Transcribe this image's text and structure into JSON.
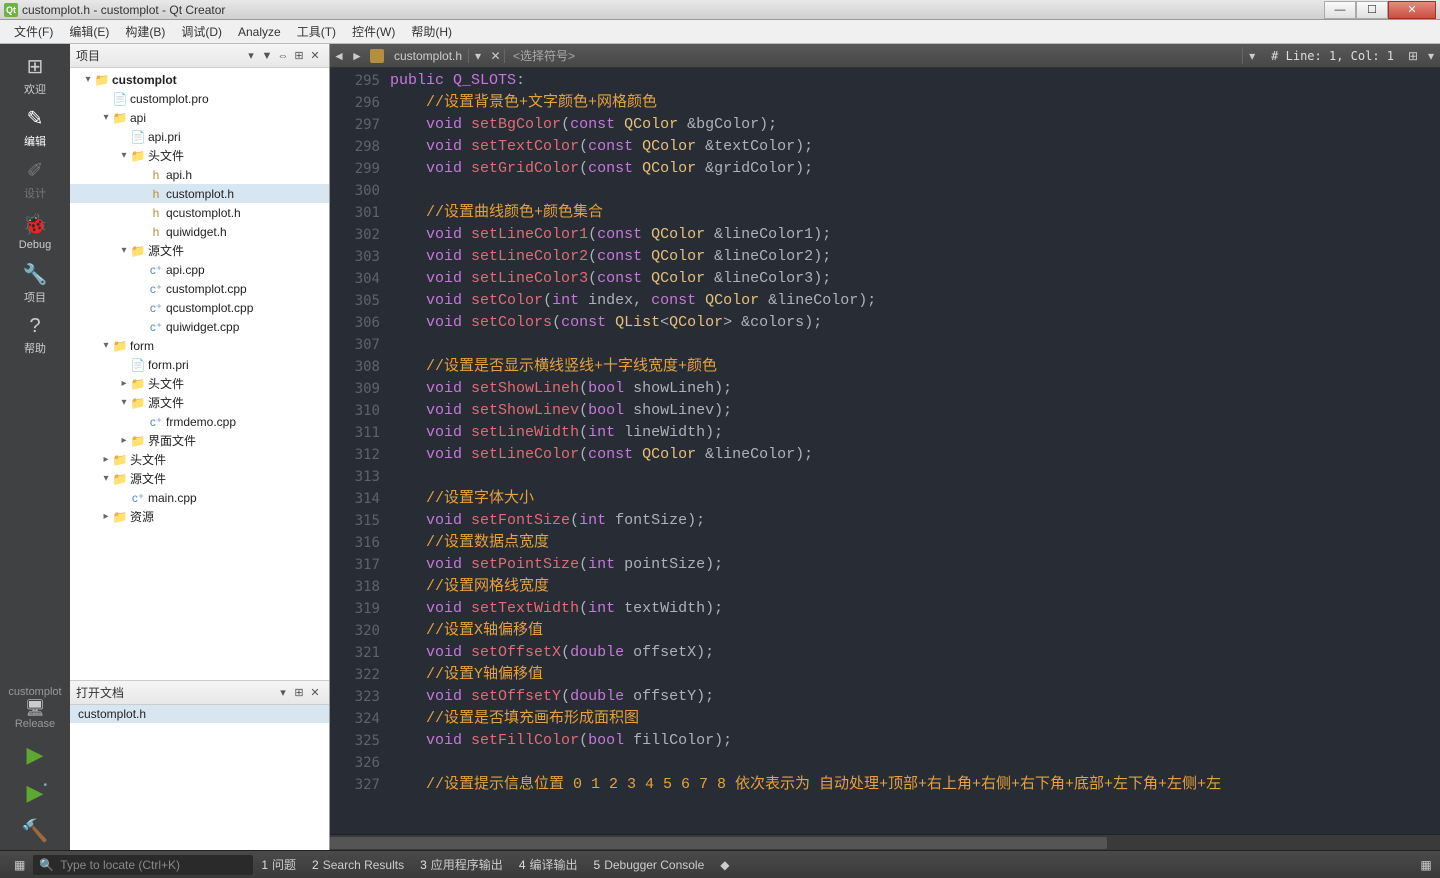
{
  "window": {
    "title": "customplot.h - customplot - Qt Creator"
  },
  "menus": [
    "文件(F)",
    "编辑(E)",
    "构建(B)",
    "调试(D)",
    "Analyze",
    "工具(T)",
    "控件(W)",
    "帮助(H)"
  ],
  "modes": [
    {
      "icon": "⊞",
      "label": "欢迎"
    },
    {
      "icon": "✎",
      "label": "编辑",
      "active": true
    },
    {
      "icon": "✐",
      "label": "设计",
      "dim": true
    },
    {
      "icon": "🐞",
      "label": "Debug"
    },
    {
      "icon": "🔧",
      "label": "项目"
    },
    {
      "icon": "?",
      "label": "帮助"
    }
  ],
  "kit": {
    "project": "customplot",
    "config": "Release"
  },
  "projectPanel": {
    "title": "项目"
  },
  "tree": [
    {
      "d": 0,
      "tw": "▾",
      "icon": "folder",
      "name": "customplot",
      "bold": true
    },
    {
      "d": 1,
      "tw": "",
      "icon": "pro",
      "name": "customplot.pro"
    },
    {
      "d": 1,
      "tw": "▾",
      "icon": "folder",
      "name": "api"
    },
    {
      "d": 2,
      "tw": "",
      "icon": "pri",
      "name": "api.pri"
    },
    {
      "d": 2,
      "tw": "▾",
      "icon": "folder",
      "name": "头文件"
    },
    {
      "d": 3,
      "tw": "",
      "icon": "h",
      "name": "api.h"
    },
    {
      "d": 3,
      "tw": "",
      "icon": "h",
      "name": "customplot.h",
      "sel": true
    },
    {
      "d": 3,
      "tw": "",
      "icon": "h",
      "name": "qcustomplot.h"
    },
    {
      "d": 3,
      "tw": "",
      "icon": "h",
      "name": "quiwidget.h"
    },
    {
      "d": 2,
      "tw": "▾",
      "icon": "folder",
      "name": "源文件"
    },
    {
      "d": 3,
      "tw": "",
      "icon": "cpp",
      "name": "api.cpp"
    },
    {
      "d": 3,
      "tw": "",
      "icon": "cpp",
      "name": "customplot.cpp"
    },
    {
      "d": 3,
      "tw": "",
      "icon": "cpp",
      "name": "qcustomplot.cpp"
    },
    {
      "d": 3,
      "tw": "",
      "icon": "cpp",
      "name": "quiwidget.cpp"
    },
    {
      "d": 1,
      "tw": "▾",
      "icon": "folder",
      "name": "form"
    },
    {
      "d": 2,
      "tw": "",
      "icon": "pri",
      "name": "form.pri"
    },
    {
      "d": 2,
      "tw": "▸",
      "icon": "folder",
      "name": "头文件"
    },
    {
      "d": 2,
      "tw": "▾",
      "icon": "folder",
      "name": "源文件"
    },
    {
      "d": 3,
      "tw": "",
      "icon": "cpp",
      "name": "frmdemo.cpp"
    },
    {
      "d": 2,
      "tw": "▸",
      "icon": "folder",
      "name": "界面文件"
    },
    {
      "d": 1,
      "tw": "▸",
      "icon": "folder",
      "name": "头文件"
    },
    {
      "d": 1,
      "tw": "▾",
      "icon": "folder",
      "name": "源文件"
    },
    {
      "d": 2,
      "tw": "",
      "icon": "cpp",
      "name": "main.cpp"
    },
    {
      "d": 1,
      "tw": "▸",
      "icon": "folder",
      "name": "资源"
    }
  ],
  "openDocs": {
    "title": "打开文档",
    "items": [
      "customplot.h"
    ]
  },
  "editorBar": {
    "file": "customplot.h",
    "symbol": "<选择符号>",
    "lineinfo": "# Line: 1, Col: 1"
  },
  "code": {
    "startLine": 295,
    "lines": [
      [
        [
          "kw",
          "public"
        ],
        [
          "plain",
          " "
        ],
        [
          "macro",
          "Q_SLOTS"
        ],
        [
          "punct",
          ":"
        ]
      ],
      [
        [
          "plain",
          "    "
        ],
        [
          "comment",
          "//设置背景色+文字颜色+网格颜色"
        ]
      ],
      [
        [
          "plain",
          "    "
        ],
        [
          "kw",
          "void"
        ],
        [
          "plain",
          " "
        ],
        [
          "fn",
          "setBgColor"
        ],
        [
          "punct",
          "("
        ],
        [
          "kw",
          "const"
        ],
        [
          "plain",
          " "
        ],
        [
          "cls",
          "QColor"
        ],
        [
          "plain",
          " "
        ],
        [
          "param",
          "&bgColor"
        ],
        [
          "punct",
          ");"
        ]
      ],
      [
        [
          "plain",
          "    "
        ],
        [
          "kw",
          "void"
        ],
        [
          "plain",
          " "
        ],
        [
          "fn",
          "setTextColor"
        ],
        [
          "punct",
          "("
        ],
        [
          "kw",
          "const"
        ],
        [
          "plain",
          " "
        ],
        [
          "cls",
          "QColor"
        ],
        [
          "plain",
          " "
        ],
        [
          "param",
          "&textColor"
        ],
        [
          "punct",
          ");"
        ]
      ],
      [
        [
          "plain",
          "    "
        ],
        [
          "kw",
          "void"
        ],
        [
          "plain",
          " "
        ],
        [
          "fn",
          "setGridColor"
        ],
        [
          "punct",
          "("
        ],
        [
          "kw",
          "const"
        ],
        [
          "plain",
          " "
        ],
        [
          "cls",
          "QColor"
        ],
        [
          "plain",
          " "
        ],
        [
          "param",
          "&gridColor"
        ],
        [
          "punct",
          ");"
        ]
      ],
      [],
      [
        [
          "plain",
          "    "
        ],
        [
          "comment",
          "//设置曲线颜色+颜色集合"
        ]
      ],
      [
        [
          "plain",
          "    "
        ],
        [
          "kw",
          "void"
        ],
        [
          "plain",
          " "
        ],
        [
          "fn",
          "setLineColor1"
        ],
        [
          "punct",
          "("
        ],
        [
          "kw",
          "const"
        ],
        [
          "plain",
          " "
        ],
        [
          "cls",
          "QColor"
        ],
        [
          "plain",
          " "
        ],
        [
          "param",
          "&lineColor1"
        ],
        [
          "punct",
          ");"
        ]
      ],
      [
        [
          "plain",
          "    "
        ],
        [
          "kw",
          "void"
        ],
        [
          "plain",
          " "
        ],
        [
          "fn",
          "setLineColor2"
        ],
        [
          "punct",
          "("
        ],
        [
          "kw",
          "const"
        ],
        [
          "plain",
          " "
        ],
        [
          "cls",
          "QColor"
        ],
        [
          "plain",
          " "
        ],
        [
          "param",
          "&lineColor2"
        ],
        [
          "punct",
          ");"
        ]
      ],
      [
        [
          "plain",
          "    "
        ],
        [
          "kw",
          "void"
        ],
        [
          "plain",
          " "
        ],
        [
          "fn",
          "setLineColor3"
        ],
        [
          "punct",
          "("
        ],
        [
          "kw",
          "const"
        ],
        [
          "plain",
          " "
        ],
        [
          "cls",
          "QColor"
        ],
        [
          "plain",
          " "
        ],
        [
          "param",
          "&lineColor3"
        ],
        [
          "punct",
          ");"
        ]
      ],
      [
        [
          "plain",
          "    "
        ],
        [
          "kw",
          "void"
        ],
        [
          "plain",
          " "
        ],
        [
          "fn",
          "setColor"
        ],
        [
          "punct",
          "("
        ],
        [
          "kw",
          "int"
        ],
        [
          "plain",
          " "
        ],
        [
          "param",
          "index"
        ],
        [
          "punct",
          ", "
        ],
        [
          "kw",
          "const"
        ],
        [
          "plain",
          " "
        ],
        [
          "cls",
          "QColor"
        ],
        [
          "plain",
          " "
        ],
        [
          "param",
          "&lineColor"
        ],
        [
          "punct",
          ");"
        ]
      ],
      [
        [
          "plain",
          "    "
        ],
        [
          "kw",
          "void"
        ],
        [
          "plain",
          " "
        ],
        [
          "fn",
          "setColors"
        ],
        [
          "punct",
          "("
        ],
        [
          "kw",
          "const"
        ],
        [
          "plain",
          " "
        ],
        [
          "cls",
          "QList"
        ],
        [
          "punct",
          "<"
        ],
        [
          "cls",
          "QColor"
        ],
        [
          "punct",
          "> "
        ],
        [
          "param",
          "&colors"
        ],
        [
          "punct",
          ");"
        ]
      ],
      [],
      [
        [
          "plain",
          "    "
        ],
        [
          "comment",
          "//设置是否显示横线竖线+十字线宽度+颜色"
        ]
      ],
      [
        [
          "plain",
          "    "
        ],
        [
          "kw",
          "void"
        ],
        [
          "plain",
          " "
        ],
        [
          "fn",
          "setShowLineh"
        ],
        [
          "punct",
          "("
        ],
        [
          "kw",
          "bool"
        ],
        [
          "plain",
          " "
        ],
        [
          "param",
          "showLineh"
        ],
        [
          "punct",
          ");"
        ]
      ],
      [
        [
          "plain",
          "    "
        ],
        [
          "kw",
          "void"
        ],
        [
          "plain",
          " "
        ],
        [
          "fn",
          "setShowLinev"
        ],
        [
          "punct",
          "("
        ],
        [
          "kw",
          "bool"
        ],
        [
          "plain",
          " "
        ],
        [
          "param",
          "showLinev"
        ],
        [
          "punct",
          ");"
        ]
      ],
      [
        [
          "plain",
          "    "
        ],
        [
          "kw",
          "void"
        ],
        [
          "plain",
          " "
        ],
        [
          "fn",
          "setLineWidth"
        ],
        [
          "punct",
          "("
        ],
        [
          "kw",
          "int"
        ],
        [
          "plain",
          " "
        ],
        [
          "param",
          "lineWidth"
        ],
        [
          "punct",
          ");"
        ]
      ],
      [
        [
          "plain",
          "    "
        ],
        [
          "kw",
          "void"
        ],
        [
          "plain",
          " "
        ],
        [
          "fn",
          "setLineColor"
        ],
        [
          "punct",
          "("
        ],
        [
          "kw",
          "const"
        ],
        [
          "plain",
          " "
        ],
        [
          "cls",
          "QColor"
        ],
        [
          "plain",
          " "
        ],
        [
          "param",
          "&lineColor"
        ],
        [
          "punct",
          ");"
        ]
      ],
      [],
      [
        [
          "plain",
          "    "
        ],
        [
          "comment",
          "//设置字体大小"
        ]
      ],
      [
        [
          "plain",
          "    "
        ],
        [
          "kw",
          "void"
        ],
        [
          "plain",
          " "
        ],
        [
          "fn",
          "setFontSize"
        ],
        [
          "punct",
          "("
        ],
        [
          "kw",
          "int"
        ],
        [
          "plain",
          " "
        ],
        [
          "param",
          "fontSize"
        ],
        [
          "punct",
          ");"
        ]
      ],
      [
        [
          "plain",
          "    "
        ],
        [
          "comment",
          "//设置数据点宽度"
        ]
      ],
      [
        [
          "plain",
          "    "
        ],
        [
          "kw",
          "void"
        ],
        [
          "plain",
          " "
        ],
        [
          "fn",
          "setPointSize"
        ],
        [
          "punct",
          "("
        ],
        [
          "kw",
          "int"
        ],
        [
          "plain",
          " "
        ],
        [
          "param",
          "pointSize"
        ],
        [
          "punct",
          ");"
        ]
      ],
      [
        [
          "plain",
          "    "
        ],
        [
          "comment",
          "//设置网格线宽度"
        ]
      ],
      [
        [
          "plain",
          "    "
        ],
        [
          "kw",
          "void"
        ],
        [
          "plain",
          " "
        ],
        [
          "fn",
          "setTextWidth"
        ],
        [
          "punct",
          "("
        ],
        [
          "kw",
          "int"
        ],
        [
          "plain",
          " "
        ],
        [
          "param",
          "textWidth"
        ],
        [
          "punct",
          ");"
        ]
      ],
      [
        [
          "plain",
          "    "
        ],
        [
          "comment",
          "//设置X轴偏移值"
        ]
      ],
      [
        [
          "plain",
          "    "
        ],
        [
          "kw",
          "void"
        ],
        [
          "plain",
          " "
        ],
        [
          "fn",
          "setOffsetX"
        ],
        [
          "punct",
          "("
        ],
        [
          "kw",
          "double"
        ],
        [
          "plain",
          " "
        ],
        [
          "param",
          "offsetX"
        ],
        [
          "punct",
          ");"
        ]
      ],
      [
        [
          "plain",
          "    "
        ],
        [
          "comment",
          "//设置Y轴偏移值"
        ]
      ],
      [
        [
          "plain",
          "    "
        ],
        [
          "kw",
          "void"
        ],
        [
          "plain",
          " "
        ],
        [
          "fn",
          "setOffsetY"
        ],
        [
          "punct",
          "("
        ],
        [
          "kw",
          "double"
        ],
        [
          "plain",
          " "
        ],
        [
          "param",
          "offsetY"
        ],
        [
          "punct",
          ");"
        ]
      ],
      [
        [
          "plain",
          "    "
        ],
        [
          "comment",
          "//设置是否填充画布形成面积图"
        ]
      ],
      [
        [
          "plain",
          "    "
        ],
        [
          "kw",
          "void"
        ],
        [
          "plain",
          " "
        ],
        [
          "fn",
          "setFillColor"
        ],
        [
          "punct",
          "("
        ],
        [
          "kw",
          "bool"
        ],
        [
          "plain",
          " "
        ],
        [
          "param",
          "fillColor"
        ],
        [
          "punct",
          ");"
        ]
      ],
      [],
      [
        [
          "plain",
          "    "
        ],
        [
          "comment",
          "//设置提示信息位置 0 1 2 3 4 5 6 7 8 依次表示为 自动处理+顶部+右上角+右侧+右下角+底部+左下角+左侧+左"
        ]
      ]
    ]
  },
  "bottom": {
    "searchPlaceholder": "Type to locate (Ctrl+K)",
    "panes": [
      {
        "n": "1",
        "label": "问题"
      },
      {
        "n": "2",
        "label": "Search Results"
      },
      {
        "n": "3",
        "label": "应用程序输出"
      },
      {
        "n": "4",
        "label": "编译输出"
      },
      {
        "n": "5",
        "label": "Debugger Console"
      }
    ]
  }
}
